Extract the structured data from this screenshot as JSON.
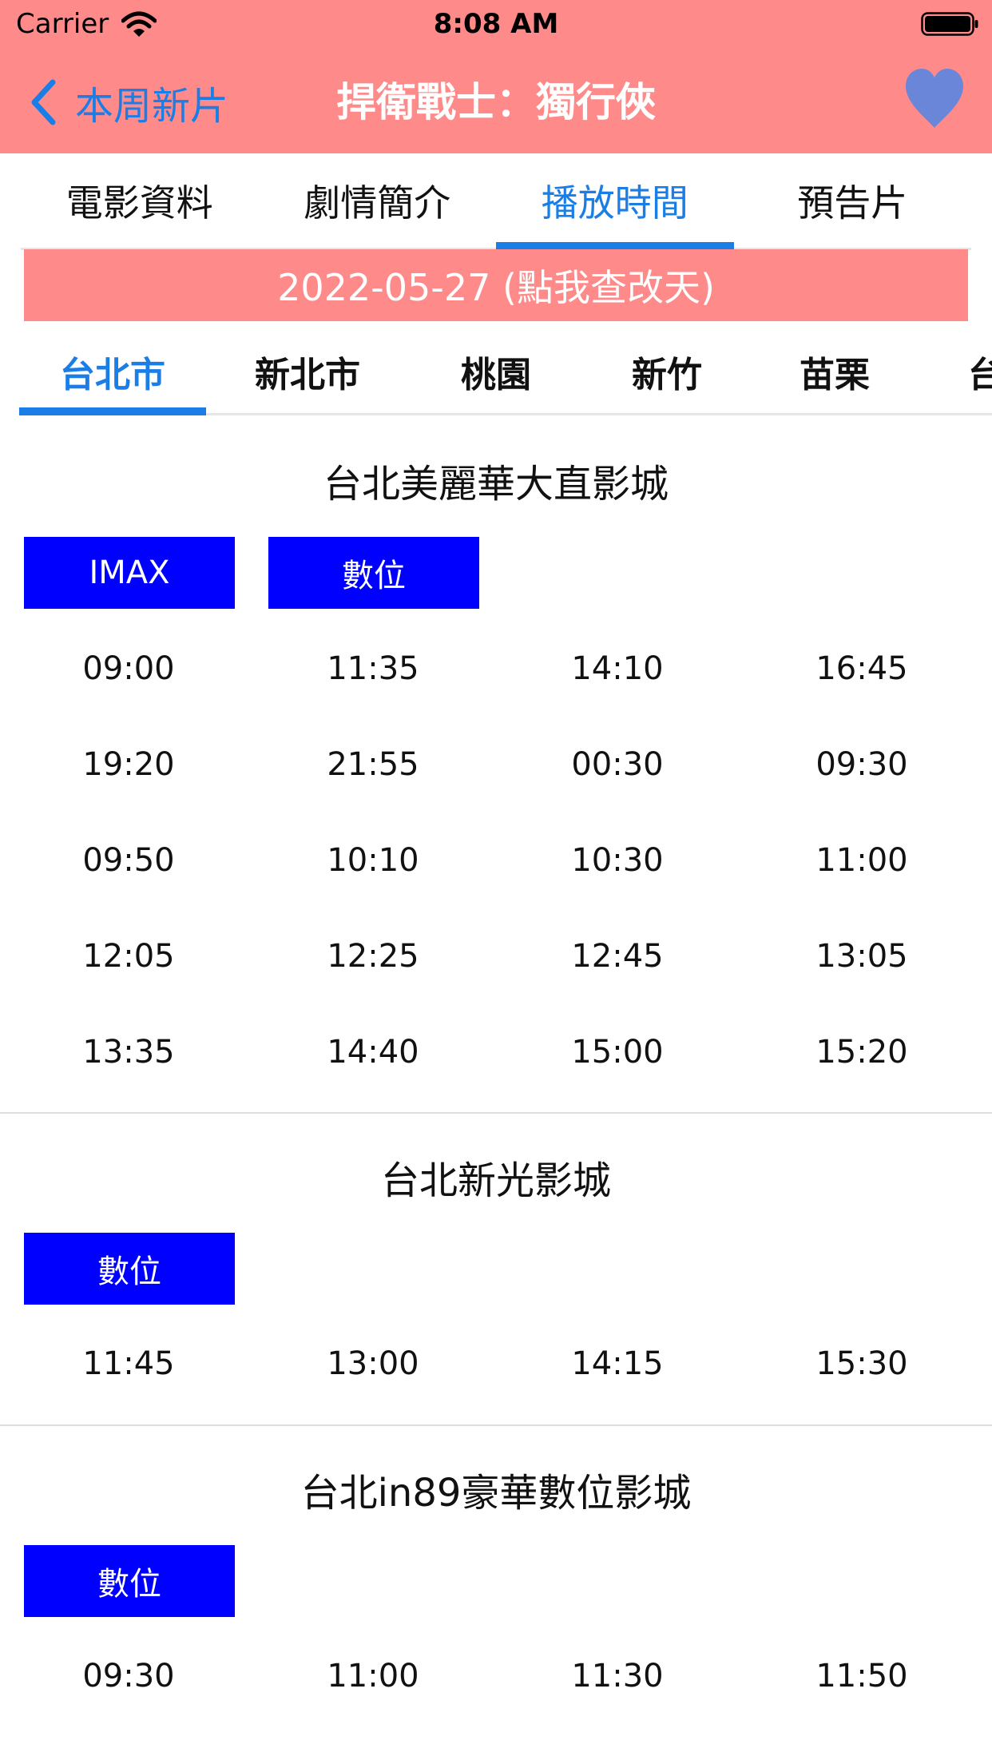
{
  "status_bar": {
    "carrier": "Carrier",
    "time": "8:08 AM"
  },
  "nav": {
    "back_label": "本周新片",
    "title": "捍衛戰士：獨行俠",
    "favorite_icon": "heart-icon",
    "accent": "#1a7ee6",
    "header_color": "#ff8a8a"
  },
  "tabs": [
    {
      "label": "電影資料",
      "active": false
    },
    {
      "label": "劇情簡介",
      "active": false
    },
    {
      "label": "播放時間",
      "active": true
    },
    {
      "label": "預告片",
      "active": false
    }
  ],
  "date_selector": {
    "label": "2022-05-27 (點我查改天)"
  },
  "cities": [
    {
      "label": "台北市",
      "active": true
    },
    {
      "label": "新北市",
      "active": false
    },
    {
      "label": "桃園",
      "active": false
    },
    {
      "label": "新竹",
      "active": false
    },
    {
      "label": "苗栗",
      "active": false
    },
    {
      "label": "台",
      "active": false
    }
  ],
  "theaters": [
    {
      "name": "台北美麗華大直影城",
      "formats": [
        "IMAX",
        "數位"
      ],
      "showtimes": [
        "09:00",
        "11:35",
        "14:10",
        "16:45",
        "19:20",
        "21:55",
        "00:30",
        "09:30",
        "09:50",
        "10:10",
        "10:30",
        "11:00",
        "12:05",
        "12:25",
        "12:45",
        "13:05",
        "13:35",
        "14:40",
        "15:00",
        "15:20"
      ]
    },
    {
      "name": "台北新光影城",
      "formats": [
        "數位"
      ],
      "showtimes": [
        "11:45",
        "13:00",
        "14:15",
        "15:30"
      ]
    },
    {
      "name": "台北in89豪華數位影城",
      "formats": [
        "數位"
      ],
      "showtimes": [
        "09:30",
        "11:00",
        "11:30",
        "11:50"
      ]
    }
  ]
}
